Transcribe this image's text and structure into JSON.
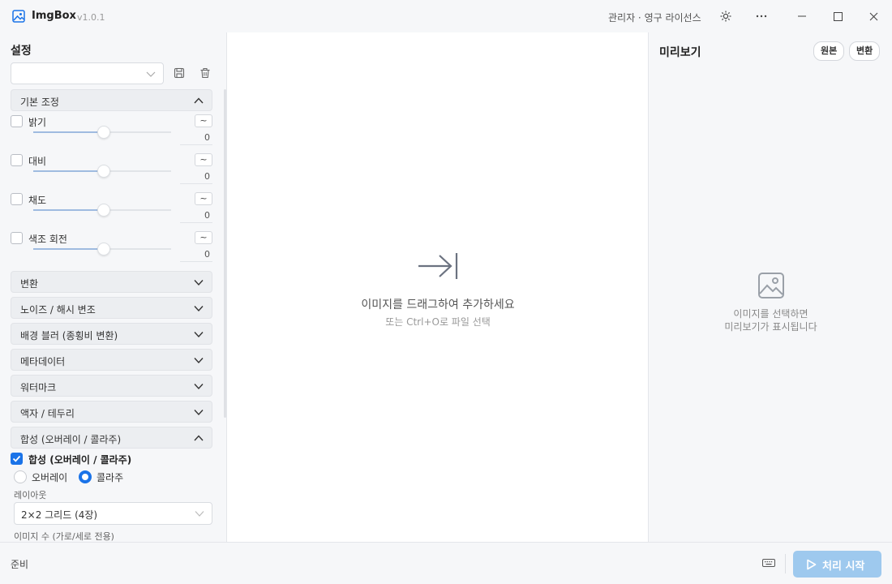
{
  "titlebar": {
    "app_name": "ImgBox",
    "version": "v1.0.1",
    "license": "관리자 · 영구 라이선스",
    "icons": [
      "theme-icon",
      "more-icon",
      "minimize-icon",
      "maximize-icon",
      "close-icon"
    ]
  },
  "sidebar": {
    "title": "설정",
    "preset_value": "",
    "sections": {
      "basic": "기본 조정",
      "transform": "변환",
      "noise": "노이즈 / 해시 변조",
      "bg_blur": "배경 블러 (종횡비 변환)",
      "metadata": "메타데이터",
      "watermark": "워터마크",
      "frame": "액자 / 테두리",
      "composite": "합성 (오버레이 / 콜라주)"
    },
    "adjustments": [
      {
        "label": "밝기",
        "value": "0",
        "level": 0.5,
        "checked": false
      },
      {
        "label": "대비",
        "value": "0",
        "level": 0.5,
        "checked": false
      },
      {
        "label": "채도",
        "value": "0",
        "level": 0.5,
        "checked": false
      },
      {
        "label": "색조 회전",
        "value": "0",
        "level": 0.5,
        "checked": false
      }
    ],
    "tilde": "~",
    "composite": {
      "checkbox_label": "합성 (오버레이 / 콜라주)",
      "checked": true,
      "radio_overlay": "오버레이",
      "radio_collage": "콜라주",
      "selected": "콜라주",
      "layout_label": "레이아웃",
      "layout_value": "2×2 그리드 (4장)",
      "count_label": "이미지 수 (가로/세로 전용)"
    }
  },
  "main": {
    "drop_text": "이미지를 드래그하여 추가하세요",
    "drop_sub": "또는 Ctrl+O로 파일 선택"
  },
  "preview": {
    "title": "미리보기",
    "btn_original": "원본",
    "btn_converted": "변환",
    "empty_line1": "이미지를 선택하면",
    "empty_line2": "미리보기가 표시됩니다"
  },
  "status": {
    "text": "준비",
    "start_label": "처리 시작"
  },
  "colors": {
    "accent": "#1a73e8",
    "start_button": "#9ec9ee",
    "panel_bg": "#f6f7f9"
  }
}
